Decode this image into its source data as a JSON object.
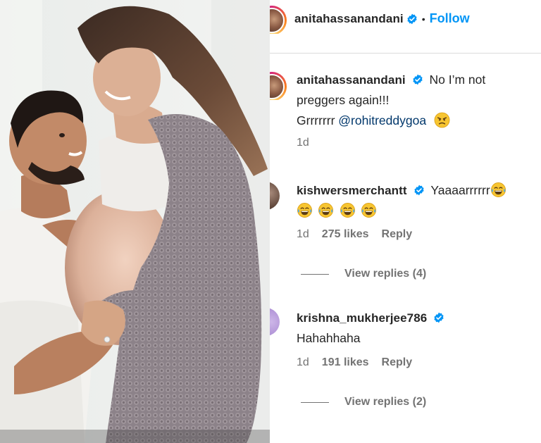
{
  "post": {
    "photo_alt": "",
    "header": {
      "username": "anitahassanandani",
      "separator": "•",
      "follow_label": "Follow"
    },
    "caption": {
      "username": "anitahassanandani",
      "text_line1": "No I’m not",
      "text_line2": "preggers again!!!",
      "text_line3_prefix": "Grrrrrrr ",
      "mention": "@rohitreddygoa",
      "emoji": "angry-face",
      "time": "1d"
    },
    "comments": [
      {
        "username": "kishwersmerchantt",
        "text": "Yaaaarrrrrr",
        "emojis": [
          "tears-of-joy",
          "tears-of-joy",
          "tears-of-joy",
          "tears-of-joy",
          "tears-of-joy"
        ],
        "time": "1d",
        "likes": "275 likes",
        "reply_label": "Reply",
        "view_replies": "View replies (4)"
      },
      {
        "username": "krishna_mukherjee786",
        "text": "Hahahhaha",
        "time": "1d",
        "likes": "191 likes",
        "reply_label": "Reply",
        "view_replies": "View replies (2)"
      }
    ],
    "colors": {
      "accent": "#0095f6",
      "verified": "#0095f6",
      "text": "#262626",
      "muted": "#737373",
      "mention": "#00376b"
    }
  }
}
